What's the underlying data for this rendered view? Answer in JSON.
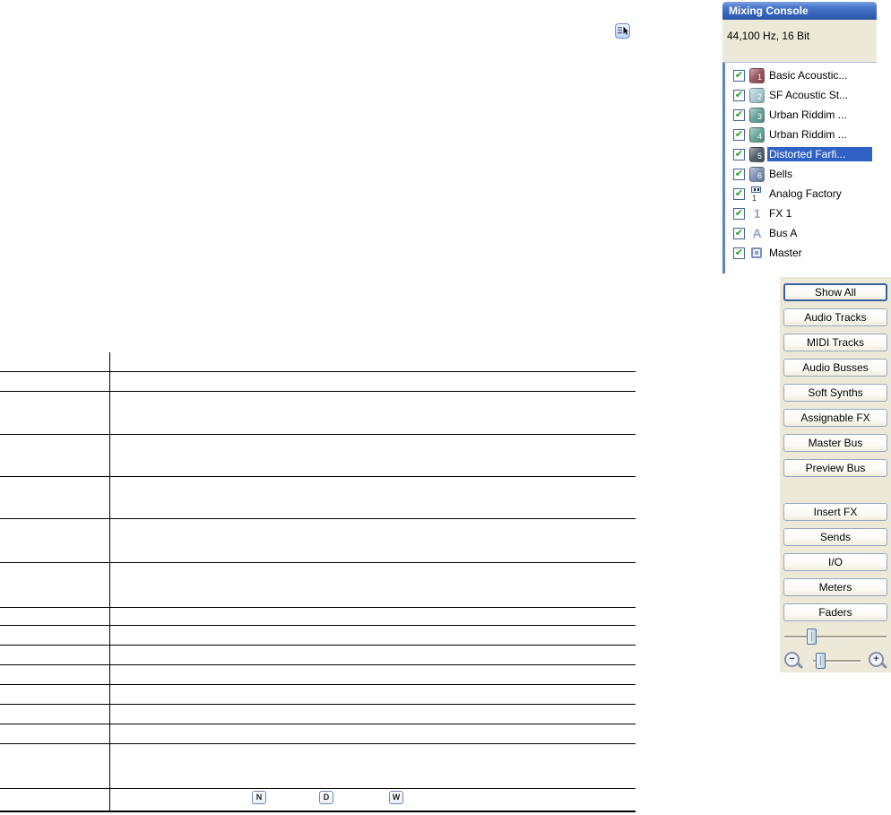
{
  "icons": {
    "checkbox_check": "✔",
    "zoom_in": "+",
    "zoom_out": "−"
  },
  "table": {
    "footer_keys": [
      "N",
      "D",
      "W"
    ]
  },
  "mixing_console": {
    "title": "Mixing Console",
    "format_info": "44,100 Hz, 16 Bit",
    "selection_color": "#2f62c4",
    "tracks": [
      {
        "badge": "1",
        "name": "Basic Acoustic...",
        "type": "audio",
        "color": "#9b5560",
        "checked": true,
        "selected": false
      },
      {
        "badge": "2",
        "name": "SF Acoustic St...",
        "type": "audio",
        "color": "#a9ccd2",
        "checked": true,
        "selected": false
      },
      {
        "badge": "3",
        "name": "Urban Riddim ...",
        "type": "audio",
        "color": "#68a69d",
        "checked": true,
        "selected": false
      },
      {
        "badge": "4",
        "name": "Urban Riddim ...",
        "type": "audio",
        "color": "#68a69d",
        "checked": true,
        "selected": false
      },
      {
        "badge": "5",
        "name": "Distorted Farfi...",
        "type": "audio",
        "color": "#535f6d",
        "checked": true,
        "selected": true
      },
      {
        "badge": "6",
        "name": "Bells",
        "type": "audio",
        "color": "#7e91b7",
        "checked": true,
        "selected": false
      },
      {
        "badge": "1",
        "name": "Analog Factory",
        "type": "soft-synth",
        "color": "",
        "checked": true,
        "selected": false
      },
      {
        "badge": "1",
        "name": "FX 1",
        "type": "assignable-fx",
        "color": "",
        "checked": true,
        "selected": false
      },
      {
        "badge": "A",
        "name": "Bus A",
        "type": "bus",
        "color": "",
        "checked": true,
        "selected": false
      },
      {
        "badge": "",
        "name": "Master",
        "type": "master",
        "color": "",
        "checked": true,
        "selected": false
      }
    ]
  },
  "console_toolbar": {
    "panel_color": "#ece9d8",
    "default_button": "Show All",
    "view_buttons": [
      "Show All",
      "Audio Tracks",
      "MIDI Tracks",
      "Audio Busses",
      "Soft Synths",
      "Assignable FX",
      "Master Bus",
      "Preview Bus"
    ],
    "section_buttons": [
      "Insert FX",
      "Sends",
      "I/O",
      "Meters",
      "Faders"
    ]
  }
}
